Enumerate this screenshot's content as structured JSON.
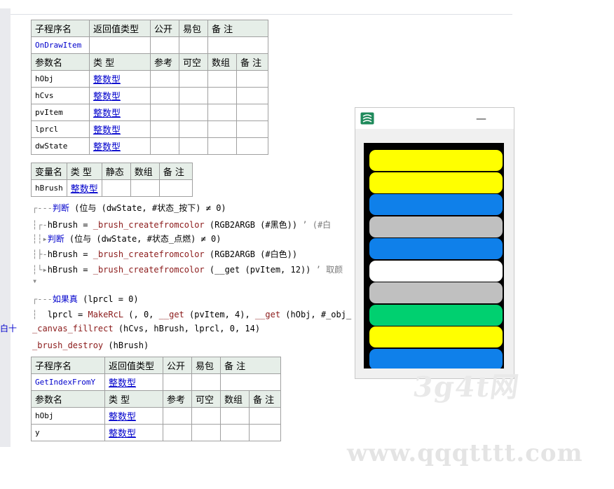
{
  "table1": {
    "sub_header": [
      "子程序名",
      "返回值类型",
      "公开",
      "易包",
      "备 注"
    ],
    "sub_row": [
      "OnDrawItem",
      "",
      "",
      "",
      ""
    ],
    "param_header": [
      "参数名",
      "类 型",
      "参考",
      "可空",
      "数组",
      "备 注"
    ],
    "params": [
      {
        "name": "hObj",
        "type": "整数型"
      },
      {
        "name": "hCvs",
        "type": "整数型"
      },
      {
        "name": "pvItem",
        "type": "整数型"
      },
      {
        "name": "lprcl",
        "type": "整数型"
      },
      {
        "name": "dwState",
        "type": "整数型"
      }
    ]
  },
  "vars": {
    "header": [
      "变量名",
      "类 型",
      "静态",
      "数组",
      "备 注"
    ],
    "rows": [
      {
        "name": "hBrush",
        "type": "整数型"
      }
    ]
  },
  "code": {
    "l1_kw": "判断",
    "l1_rest": " (位与 (dwState, #状态_按下) ≠ 0)",
    "l2_a": "hBrush = ",
    "l2_fn": "_brush_createfromcolor",
    "l2_b": " (RGB2ARGB (#黑色)) ",
    "l2_c": "’ (#白",
    "l3_kw": "判断",
    "l3_rest": " (位与 (dwState, #状态_点燃) ≠ 0)",
    "l4_a": "hBrush = ",
    "l4_fn": "_brush_createfromcolor",
    "l4_b": " (RGB2ARGB (#白色))",
    "l5_a": "hBrush = ",
    "l5_fn": "_brush_createfromcolor",
    "l5_b": " (__get (pvItem, 12)) ",
    "l5_c": "’ 取颜",
    "l6_kw": "如果真",
    "l6_rest": " (lprcl = 0)",
    "l7_a": "lprcl = ",
    "l7_fn": "MakeRcL",
    "l7_b": " (, 0, ",
    "l7_fn2": "__get",
    "l7_c": " (pvItem, 4), ",
    "l7_fn3": "__get",
    "l7_d": " (hObj, #_obj_",
    "l8_fn": "_canvas_fillrect",
    "l8_b": " (hCvs, hBrush, lprcl, 0, 14)",
    "l9_fn": "_brush_destroy",
    "l9_b": " (hBrush)",
    "margin_text": "白十"
  },
  "table2": {
    "sub_header": [
      "子程序名",
      "返回值类型",
      "公开",
      "易包",
      "备 注"
    ],
    "sub_row": [
      "GetIndexFromY",
      "整数型",
      "",
      "",
      ""
    ],
    "param_header": [
      "参数名",
      "类 型",
      "参考",
      "可空",
      "数组",
      "备 注"
    ],
    "params": [
      {
        "name": "hObj",
        "type": "整数型"
      },
      {
        "name": "y",
        "type": "整数型"
      }
    ]
  },
  "window": {
    "minimize_glyph": "—",
    "pills": [
      "#ffff00",
      "#ffff00",
      "#0f80ea",
      "#c0c0c0",
      "#0f80ea",
      "#ffffff",
      "#c0c0c0",
      "#00d070",
      "#ffff00",
      "#0f80ea"
    ]
  },
  "watermark": {
    "logo": "3g4t网",
    "site": "www.qqqtttt.com"
  }
}
